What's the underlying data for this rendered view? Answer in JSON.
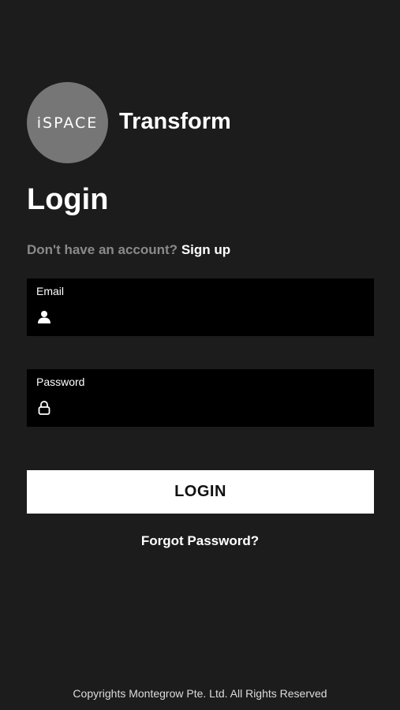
{
  "brand": {
    "logo_text": "iSPACE",
    "app_name": "Transform"
  },
  "page": {
    "title": "Login"
  },
  "signup": {
    "prompt": "Don't have an account?",
    "link_label": "Sign up"
  },
  "form": {
    "email": {
      "label": "Email",
      "icon": "user-icon",
      "value": ""
    },
    "password": {
      "label": "Password",
      "icon": "lock-icon",
      "value": ""
    },
    "login_label": "LOGIN",
    "forgot_label": "Forgot Password?"
  },
  "footer": {
    "copyright": "Copyrights Montegrow Pte. Ltd. All Rights Reserved"
  },
  "colors": {
    "background": "#1c1c1c",
    "field_background": "#000000",
    "logo_circle": "#767676",
    "button_background": "#ffffff",
    "muted_text": "#8a8a8a"
  }
}
